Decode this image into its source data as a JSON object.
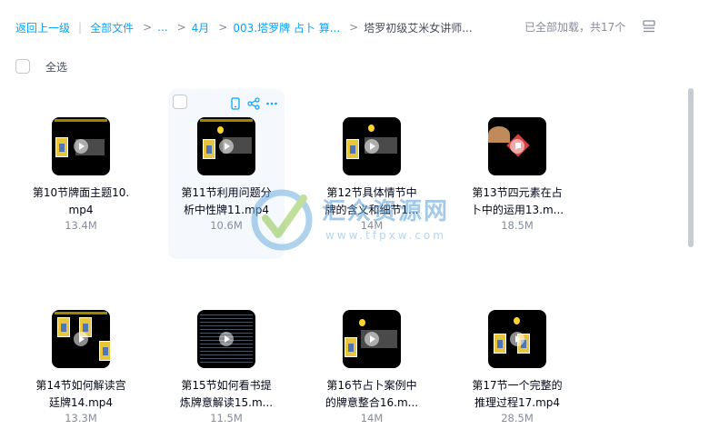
{
  "breadcrumb": {
    "back": "返回上一级",
    "all_files": "全部文件",
    "ellipsis": "...",
    "month": "4月",
    "folder": "003.塔罗牌 占卜 算...",
    "current": "塔罗初级艾米女讲师..."
  },
  "status": {
    "loaded_text": "已全部加载，共17个"
  },
  "select_all": {
    "label": "全选"
  },
  "files": [
    {
      "name_line1": "第10节牌面主题10.",
      "name_line2": "mp4",
      "size": "13.4M"
    },
    {
      "name_line1": "第11节利用问题分",
      "name_line2": "析中性牌11.mp4",
      "size": "10.6M"
    },
    {
      "name_line1": "第12节具体情节中",
      "name_line2": "牌的含义和细节1...",
      "size": "14M"
    },
    {
      "name_line1": "第13节四元素在占",
      "name_line2": "卜中的运用13.m...",
      "size": "18.5M"
    },
    {
      "name_line1": "第14节如何解读宫",
      "name_line2": "廷牌14.mp4",
      "size": "13.3M"
    },
    {
      "name_line1": "第15节如何看书提",
      "name_line2": "炼牌意解读15.m...",
      "size": "11.5M"
    },
    {
      "name_line1": "第16节占卜案例中",
      "name_line2": "的牌意整合16.m...",
      "size": "14M"
    },
    {
      "name_line1": "第17节一个完整的",
      "name_line2": "推理过程17.mp4",
      "size": "28.5M"
    }
  ],
  "watermark": {
    "title": "汇众资源网",
    "url": "www.tfpxw.com"
  },
  "icons": {
    "view_toggle": "list-view-icon",
    "phone": "phone-icon",
    "share": "share-icon",
    "more": "more-icon",
    "play": "play-icon"
  },
  "colors": {
    "link": "#06a7ff",
    "muted": "#878c9c",
    "text": "#03081a",
    "hover_card": "#f5f8fc"
  }
}
